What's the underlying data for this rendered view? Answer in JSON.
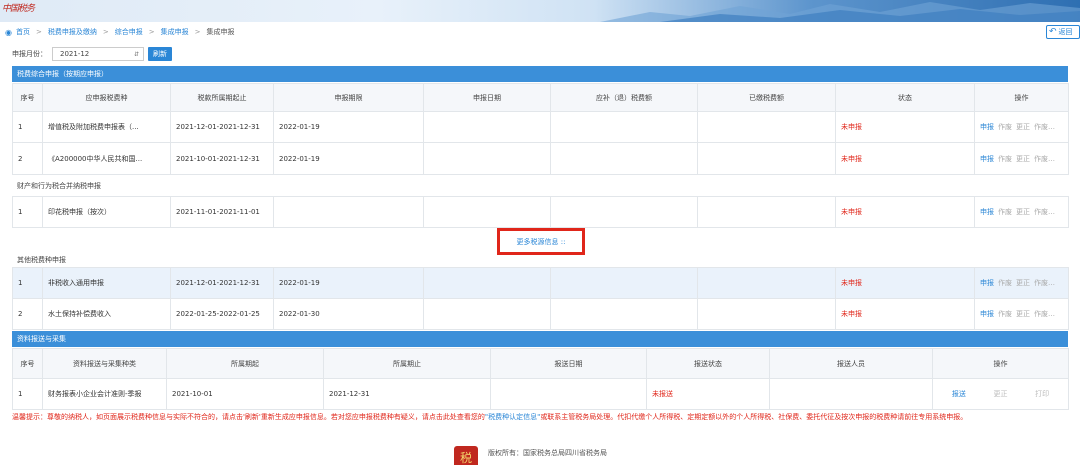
{
  "banner": {
    "logo": "中国税务"
  },
  "breadcrumb": {
    "home": "首页",
    "level2": "税费申报及缴纳",
    "level3": "综合申报",
    "level4": "集成申报",
    "current": "集成申报"
  },
  "back_button": {
    "label": "返回"
  },
  "filter": {
    "label": "申报月份：",
    "value": "2021-12",
    "refresh_label": "刷新"
  },
  "section1": {
    "title": "税费综合申报（按期应申报）",
    "headers": [
      "序号",
      "应申报税费种",
      "税款所属期起止",
      "申报期限",
      "申报日期",
      "应补（退）税费额",
      "已缴税费额",
      "状态",
      "操作"
    ],
    "rows": [
      {
        "no": "1",
        "name": "增值税及附加税费申报表（...",
        "period": "2021-12-01-2021-12-31",
        "deadline": "2022-01-19",
        "date": "",
        "due": "",
        "paid": "",
        "status": "未申报"
      },
      {
        "no": "2",
        "name": "《A200000中华人民共和国...",
        "period": "2021-10-01-2021-12-31",
        "deadline": "2022-01-19",
        "date": "",
        "due": "",
        "paid": "",
        "status": "未申报"
      }
    ],
    "group2_label": "财产和行为税合并纳税申报",
    "group2_rows": [
      {
        "no": "1",
        "name": "印花税申报（按次）",
        "period": "2021-11-01-2021-11-01",
        "deadline": "",
        "date": "",
        "due": "",
        "paid": "",
        "status": "未申报"
      }
    ],
    "ops": {
      "declare": "申报",
      "void": "作废",
      "correct": "更正",
      "invalid": "作废",
      "print": "打印"
    }
  },
  "more_link": "更多税源信息 ::",
  "section_other": {
    "label": "其他税费种申报",
    "rows": [
      {
        "no": "1",
        "name": "非税收入通用申报",
        "period": "2021-12-01-2021-12-31",
        "deadline": "2022-01-19",
        "date": "",
        "due": "",
        "paid": "",
        "status": "未申报"
      },
      {
        "no": "2",
        "name": "水土保持补偿费收入",
        "period": "2022-01-25-2022-01-25",
        "deadline": "2022-01-30",
        "date": "",
        "due": "",
        "paid": "",
        "status": "未申报"
      }
    ]
  },
  "section2": {
    "title": "资料报送与采集",
    "headers": [
      "序号",
      "资料报送与采集种类",
      "所属期起",
      "所属期止",
      "报送日期",
      "报送状态",
      "报送人员",
      "操作"
    ],
    "rows": [
      {
        "no": "1",
        "name": "财务报表小企业会计准则-季报",
        "start": "2021-10-01",
        "end": "2021-12-31",
        "date": "",
        "status": "未报送",
        "person": ""
      }
    ],
    "ops": {
      "submit": "报送",
      "correct": "更正",
      "print": "打印"
    }
  },
  "notice": {
    "part1": "温馨提示：尊敬的纳税人，如页面展示税费种信息与实际不符合的，请点击'刷新'重新生成应申报信息。若对您应申报税费种有疑义，请点击此处查看您的",
    "link": "\"税费种认定信息\"",
    "part2": "或联系主管税务局处理。代扣代缴个人所得税、定期定额以外的个人所得税、社保费、委托代征及按次申报的税费种请前往专用系统申报。"
  },
  "footer": {
    "emblem": "税",
    "copyright": "版权所有：国家税务总局四川省税务局"
  },
  "colors": {
    "accent": "#2a86d6",
    "section_bar": "#3b8fd9",
    "status_red": "#e0261a",
    "highlight_row": "#eaf2fb"
  }
}
